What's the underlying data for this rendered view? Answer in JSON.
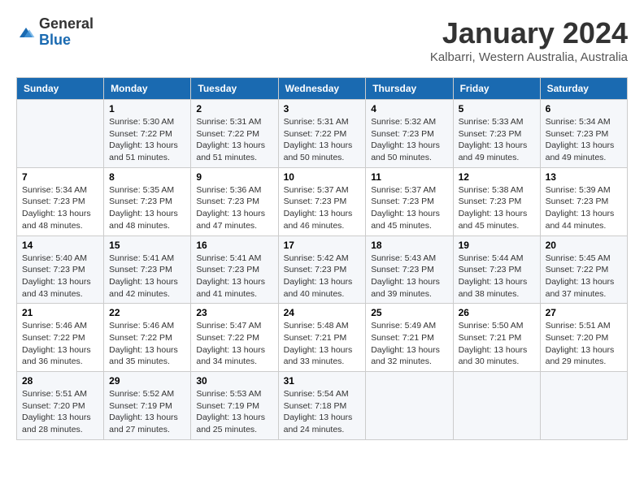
{
  "header": {
    "logo_general": "General",
    "logo_blue": "Blue",
    "month_title": "January 2024",
    "location": "Kalbarri, Western Australia, Australia"
  },
  "weekdays": [
    "Sunday",
    "Monday",
    "Tuesday",
    "Wednesday",
    "Thursday",
    "Friday",
    "Saturday"
  ],
  "weeks": [
    [
      {
        "day": "",
        "sunrise": "",
        "sunset": "",
        "daylight": ""
      },
      {
        "day": "1",
        "sunrise": "Sunrise: 5:30 AM",
        "sunset": "Sunset: 7:22 PM",
        "daylight": "Daylight: 13 hours and 51 minutes."
      },
      {
        "day": "2",
        "sunrise": "Sunrise: 5:31 AM",
        "sunset": "Sunset: 7:22 PM",
        "daylight": "Daylight: 13 hours and 51 minutes."
      },
      {
        "day": "3",
        "sunrise": "Sunrise: 5:31 AM",
        "sunset": "Sunset: 7:22 PM",
        "daylight": "Daylight: 13 hours and 50 minutes."
      },
      {
        "day": "4",
        "sunrise": "Sunrise: 5:32 AM",
        "sunset": "Sunset: 7:23 PM",
        "daylight": "Daylight: 13 hours and 50 minutes."
      },
      {
        "day": "5",
        "sunrise": "Sunrise: 5:33 AM",
        "sunset": "Sunset: 7:23 PM",
        "daylight": "Daylight: 13 hours and 49 minutes."
      },
      {
        "day": "6",
        "sunrise": "Sunrise: 5:34 AM",
        "sunset": "Sunset: 7:23 PM",
        "daylight": "Daylight: 13 hours and 49 minutes."
      }
    ],
    [
      {
        "day": "7",
        "sunrise": "Sunrise: 5:34 AM",
        "sunset": "Sunset: 7:23 PM",
        "daylight": "Daylight: 13 hours and 48 minutes."
      },
      {
        "day": "8",
        "sunrise": "Sunrise: 5:35 AM",
        "sunset": "Sunset: 7:23 PM",
        "daylight": "Daylight: 13 hours and 48 minutes."
      },
      {
        "day": "9",
        "sunrise": "Sunrise: 5:36 AM",
        "sunset": "Sunset: 7:23 PM",
        "daylight": "Daylight: 13 hours and 47 minutes."
      },
      {
        "day": "10",
        "sunrise": "Sunrise: 5:37 AM",
        "sunset": "Sunset: 7:23 PM",
        "daylight": "Daylight: 13 hours and 46 minutes."
      },
      {
        "day": "11",
        "sunrise": "Sunrise: 5:37 AM",
        "sunset": "Sunset: 7:23 PM",
        "daylight": "Daylight: 13 hours and 45 minutes."
      },
      {
        "day": "12",
        "sunrise": "Sunrise: 5:38 AM",
        "sunset": "Sunset: 7:23 PM",
        "daylight": "Daylight: 13 hours and 45 minutes."
      },
      {
        "day": "13",
        "sunrise": "Sunrise: 5:39 AM",
        "sunset": "Sunset: 7:23 PM",
        "daylight": "Daylight: 13 hours and 44 minutes."
      }
    ],
    [
      {
        "day": "14",
        "sunrise": "Sunrise: 5:40 AM",
        "sunset": "Sunset: 7:23 PM",
        "daylight": "Daylight: 13 hours and 43 minutes."
      },
      {
        "day": "15",
        "sunrise": "Sunrise: 5:41 AM",
        "sunset": "Sunset: 7:23 PM",
        "daylight": "Daylight: 13 hours and 42 minutes."
      },
      {
        "day": "16",
        "sunrise": "Sunrise: 5:41 AM",
        "sunset": "Sunset: 7:23 PM",
        "daylight": "Daylight: 13 hours and 41 minutes."
      },
      {
        "day": "17",
        "sunrise": "Sunrise: 5:42 AM",
        "sunset": "Sunset: 7:23 PM",
        "daylight": "Daylight: 13 hours and 40 minutes."
      },
      {
        "day": "18",
        "sunrise": "Sunrise: 5:43 AM",
        "sunset": "Sunset: 7:23 PM",
        "daylight": "Daylight: 13 hours and 39 minutes."
      },
      {
        "day": "19",
        "sunrise": "Sunrise: 5:44 AM",
        "sunset": "Sunset: 7:23 PM",
        "daylight": "Daylight: 13 hours and 38 minutes."
      },
      {
        "day": "20",
        "sunrise": "Sunrise: 5:45 AM",
        "sunset": "Sunset: 7:22 PM",
        "daylight": "Daylight: 13 hours and 37 minutes."
      }
    ],
    [
      {
        "day": "21",
        "sunrise": "Sunrise: 5:46 AM",
        "sunset": "Sunset: 7:22 PM",
        "daylight": "Daylight: 13 hours and 36 minutes."
      },
      {
        "day": "22",
        "sunrise": "Sunrise: 5:46 AM",
        "sunset": "Sunset: 7:22 PM",
        "daylight": "Daylight: 13 hours and 35 minutes."
      },
      {
        "day": "23",
        "sunrise": "Sunrise: 5:47 AM",
        "sunset": "Sunset: 7:22 PM",
        "daylight": "Daylight: 13 hours and 34 minutes."
      },
      {
        "day": "24",
        "sunrise": "Sunrise: 5:48 AM",
        "sunset": "Sunset: 7:21 PM",
        "daylight": "Daylight: 13 hours and 33 minutes."
      },
      {
        "day": "25",
        "sunrise": "Sunrise: 5:49 AM",
        "sunset": "Sunset: 7:21 PM",
        "daylight": "Daylight: 13 hours and 32 minutes."
      },
      {
        "day": "26",
        "sunrise": "Sunrise: 5:50 AM",
        "sunset": "Sunset: 7:21 PM",
        "daylight": "Daylight: 13 hours and 30 minutes."
      },
      {
        "day": "27",
        "sunrise": "Sunrise: 5:51 AM",
        "sunset": "Sunset: 7:20 PM",
        "daylight": "Daylight: 13 hours and 29 minutes."
      }
    ],
    [
      {
        "day": "28",
        "sunrise": "Sunrise: 5:51 AM",
        "sunset": "Sunset: 7:20 PM",
        "daylight": "Daylight: 13 hours and 28 minutes."
      },
      {
        "day": "29",
        "sunrise": "Sunrise: 5:52 AM",
        "sunset": "Sunset: 7:19 PM",
        "daylight": "Daylight: 13 hours and 27 minutes."
      },
      {
        "day": "30",
        "sunrise": "Sunrise: 5:53 AM",
        "sunset": "Sunset: 7:19 PM",
        "daylight": "Daylight: 13 hours and 25 minutes."
      },
      {
        "day": "31",
        "sunrise": "Sunrise: 5:54 AM",
        "sunset": "Sunset: 7:18 PM",
        "daylight": "Daylight: 13 hours and 24 minutes."
      },
      {
        "day": "",
        "sunrise": "",
        "sunset": "",
        "daylight": ""
      },
      {
        "day": "",
        "sunrise": "",
        "sunset": "",
        "daylight": ""
      },
      {
        "day": "",
        "sunrise": "",
        "sunset": "",
        "daylight": ""
      }
    ]
  ]
}
